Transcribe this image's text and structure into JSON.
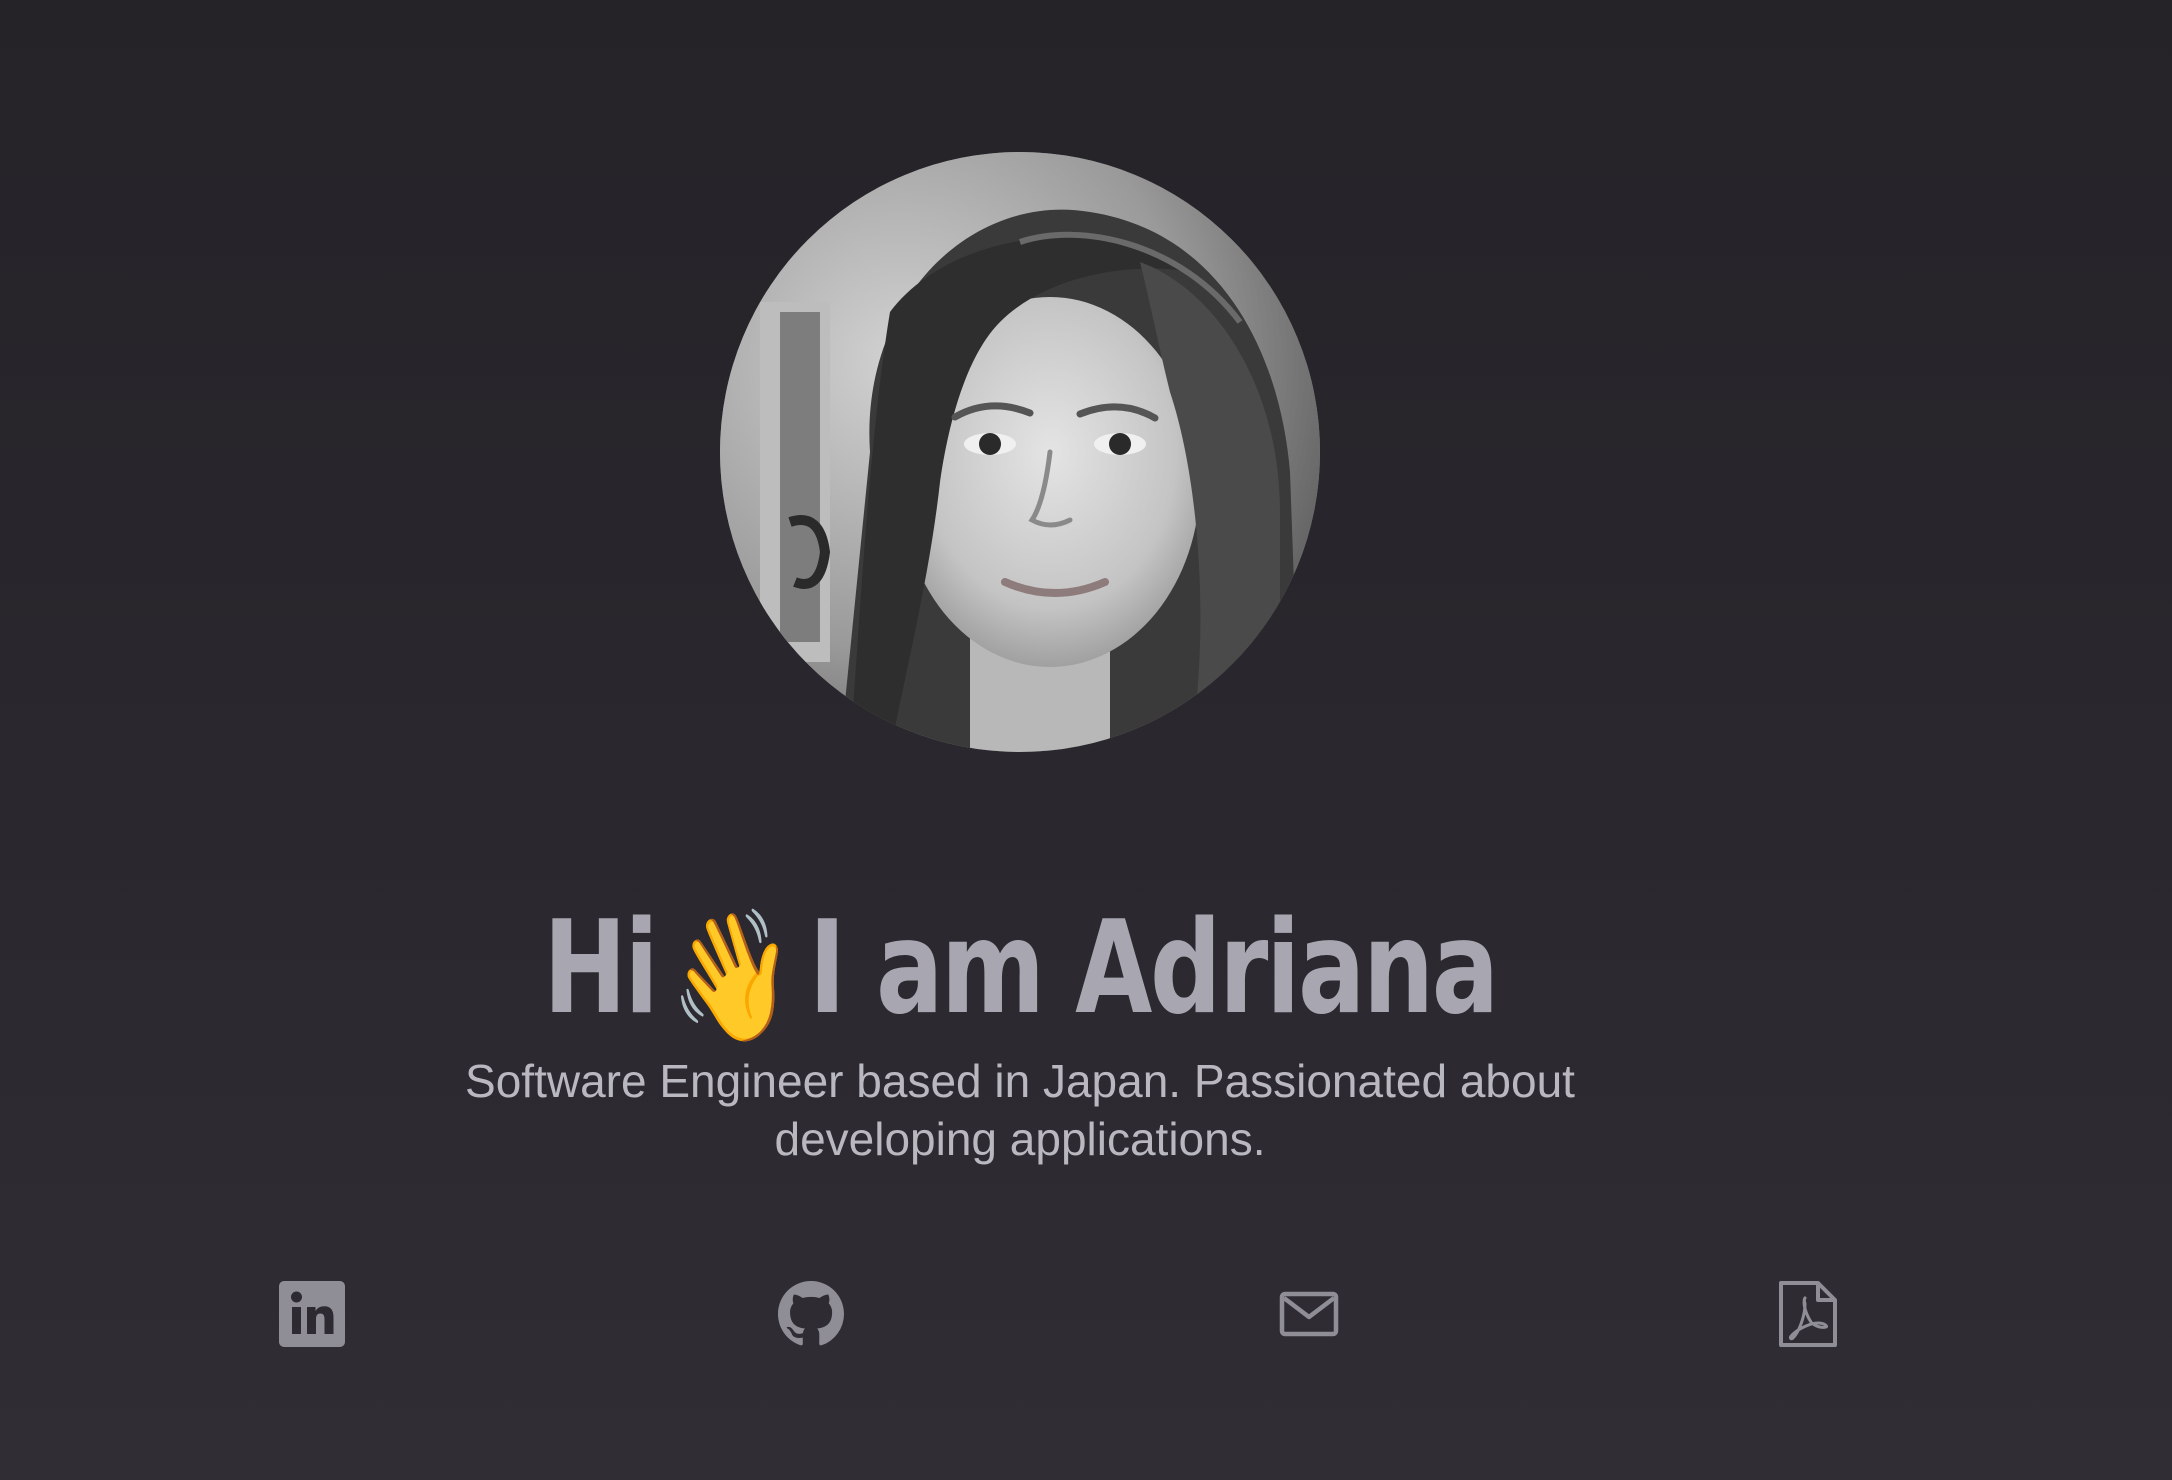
{
  "hero": {
    "avatar_alt": "Portrait photo of Adriana",
    "greeting": "Hi",
    "wave_emoji": "👋",
    "name_text": "I am Adriana",
    "subtitle": "Software Engineer based in Japan. Passionated about developing applications."
  },
  "social_links": [
    {
      "name": "linkedin",
      "icon": "linkedin-icon"
    },
    {
      "name": "github",
      "icon": "github-icon"
    },
    {
      "name": "email",
      "icon": "mail-icon"
    },
    {
      "name": "resume",
      "icon": "pdf-file-icon"
    }
  ],
  "colors": {
    "background_top": "#252328",
    "background_bottom": "#302e34",
    "heading": "#a8a6b0",
    "text": "#b9b7c0",
    "icon": "#8f8d96"
  }
}
